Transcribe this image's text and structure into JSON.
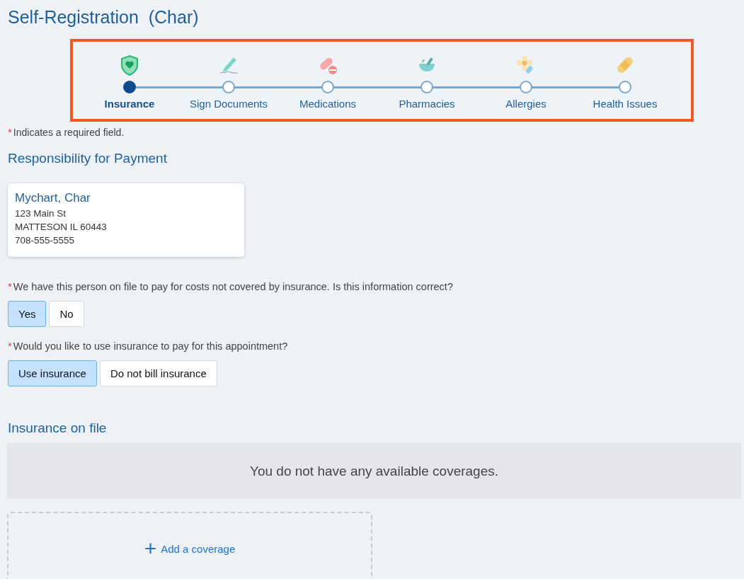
{
  "title": "Self-Registration  (Char)",
  "steps": [
    {
      "label": "Insurance",
      "selected": true
    },
    {
      "label": "Sign Documents",
      "selected": false
    },
    {
      "label": "Medications",
      "selected": false
    },
    {
      "label": "Pharmacies",
      "selected": false
    },
    {
      "label": "Allergies",
      "selected": false
    },
    {
      "label": "Health Issues",
      "selected": false
    }
  ],
  "required_note": {
    "mark": "*",
    "text": "Indicates a required field."
  },
  "responsibility": {
    "heading": "Responsibility for Payment",
    "card": {
      "name": "Mychart, Char",
      "lines": [
        "123 Main St",
        "MATTESON IL 60443",
        "708-555-5555"
      ]
    }
  },
  "questions": [
    {
      "mark": "*",
      "text": "We have this person on file to pay for costs not covered by insurance. Is this information correct?",
      "options": [
        {
          "label": "Yes",
          "selected": true
        },
        {
          "label": "No",
          "selected": false
        }
      ]
    },
    {
      "mark": "*",
      "text": "Would you like to use insurance to pay for this appointment?",
      "options": [
        {
          "label": "Use insurance",
          "selected": true
        },
        {
          "label": "Do not bill insurance",
          "selected": false
        }
      ]
    }
  ],
  "insurance": {
    "heading": "Insurance on file",
    "empty_message": "You do not have any available coverages.",
    "add_icon": "+",
    "add_label": "Add a coverage"
  }
}
